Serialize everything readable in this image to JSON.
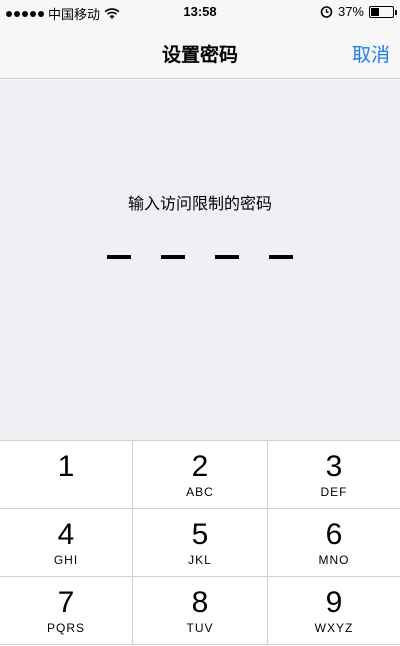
{
  "status_bar": {
    "carrier": "中国移动",
    "time": "13:58",
    "battery": "37%",
    "battery_level": 0.37,
    "icons": [
      "signal-icon",
      "wifi-icon",
      "alarm-icon",
      "battery-icon"
    ]
  },
  "nav": {
    "title": "设置密码",
    "cancel": "取消",
    "accent_color": "#157efb"
  },
  "passcode": {
    "prompt": "输入访问限制的密码",
    "digits_count": 4
  },
  "keypad": {
    "keys": [
      {
        "digit": "1",
        "letters": ""
      },
      {
        "digit": "2",
        "letters": "ABC"
      },
      {
        "digit": "3",
        "letters": "DEF"
      },
      {
        "digit": "4",
        "letters": "GHI"
      },
      {
        "digit": "5",
        "letters": "JKL"
      },
      {
        "digit": "6",
        "letters": "MNO"
      },
      {
        "digit": "7",
        "letters": "PQRS"
      },
      {
        "digit": "8",
        "letters": "TUV"
      },
      {
        "digit": "9",
        "letters": "WXYZ"
      }
    ]
  }
}
